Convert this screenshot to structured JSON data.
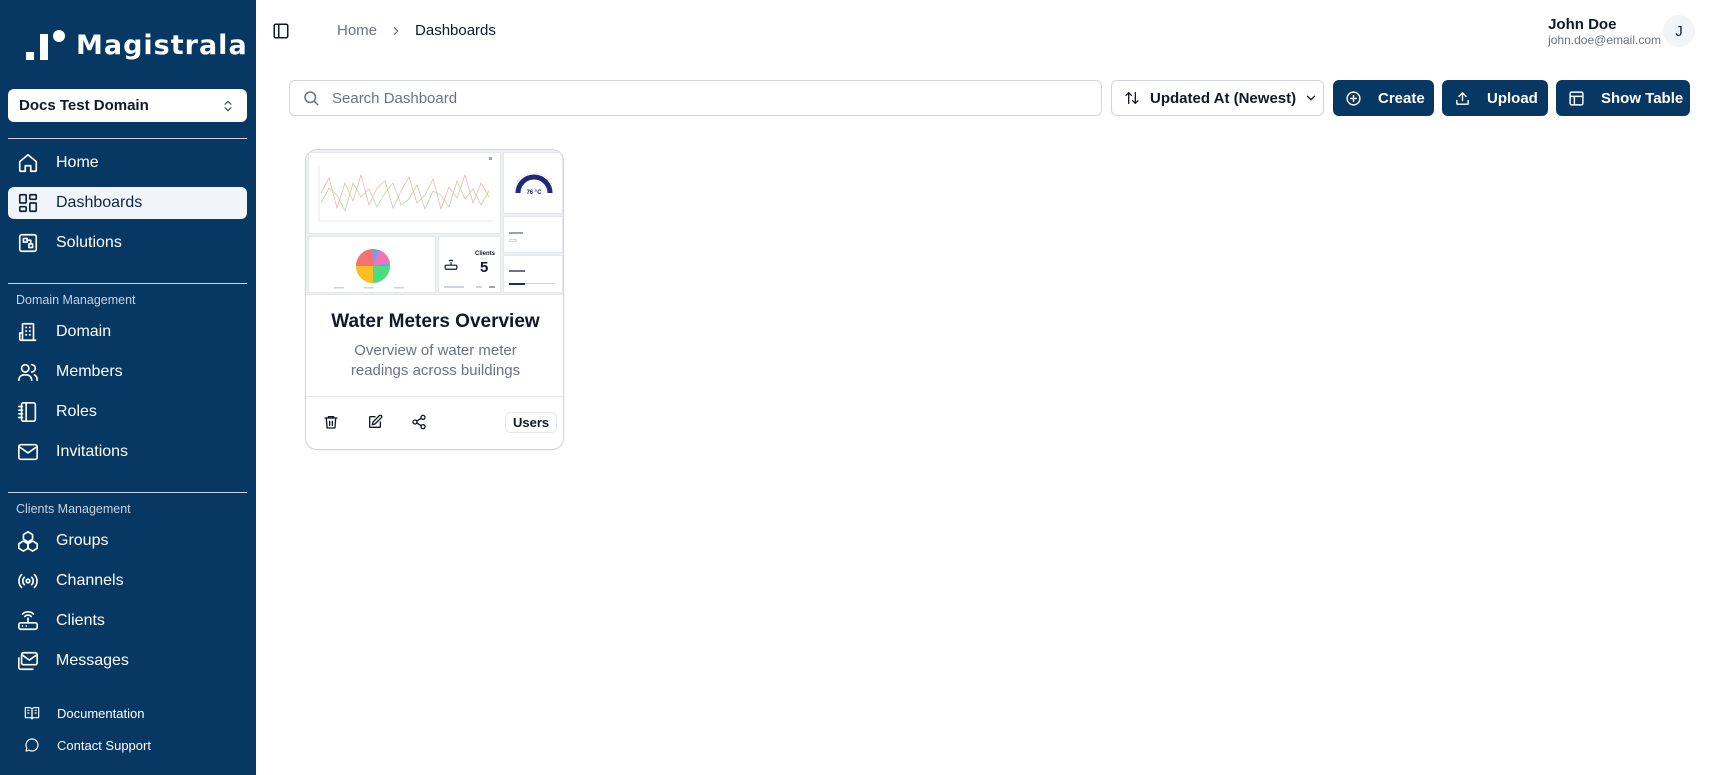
{
  "brand": {
    "name": "Magistrala"
  },
  "domain_selector": {
    "value": "Docs Test Domain"
  },
  "sidebar": {
    "main_items": [
      {
        "label": "Home",
        "icon": "home-icon"
      },
      {
        "label": "Dashboards",
        "icon": "dashboard-icon",
        "active": true
      },
      {
        "label": "Solutions",
        "icon": "solutions-icon"
      }
    ],
    "domain_section": {
      "label": "Domain Management",
      "items": [
        {
          "label": "Domain",
          "icon": "building-icon"
        },
        {
          "label": "Members",
          "icon": "users-icon"
        },
        {
          "label": "Roles",
          "icon": "notebook-icon"
        },
        {
          "label": "Invitations",
          "icon": "mail-icon"
        }
      ]
    },
    "clients_section": {
      "label": "Clients Management",
      "items": [
        {
          "label": "Groups",
          "icon": "groups-icon"
        },
        {
          "label": "Channels",
          "icon": "radio-icon"
        },
        {
          "label": "Clients",
          "icon": "router-icon"
        },
        {
          "label": "Messages",
          "icon": "messages-icon"
        }
      ]
    },
    "footer_items": [
      {
        "label": "Documentation",
        "icon": "book-icon"
      },
      {
        "label": "Contact Support",
        "icon": "chat-icon"
      }
    ]
  },
  "breadcrumb": {
    "home": "Home",
    "current": "Dashboards"
  },
  "user": {
    "name": "John Doe",
    "email": "john.doe@email.com",
    "initial": "J"
  },
  "toolbar": {
    "search_placeholder": "Search Dashboard",
    "sort_label": "Updated At (Newest)",
    "create_label": "Create",
    "upload_label": "Upload",
    "show_table_label": "Show Table"
  },
  "dashboard_card": {
    "title": "Water Meters Overview",
    "description": "Overview of water meter readings across buildings",
    "badge": "Users",
    "preview": {
      "gauge_value": "76 °C",
      "clients_label": "Clients",
      "clients_value": "5"
    }
  },
  "colors": {
    "sidebar_bg": "#073763",
    "accent": "#073763",
    "active_item_bg": "#f1f5f9"
  }
}
